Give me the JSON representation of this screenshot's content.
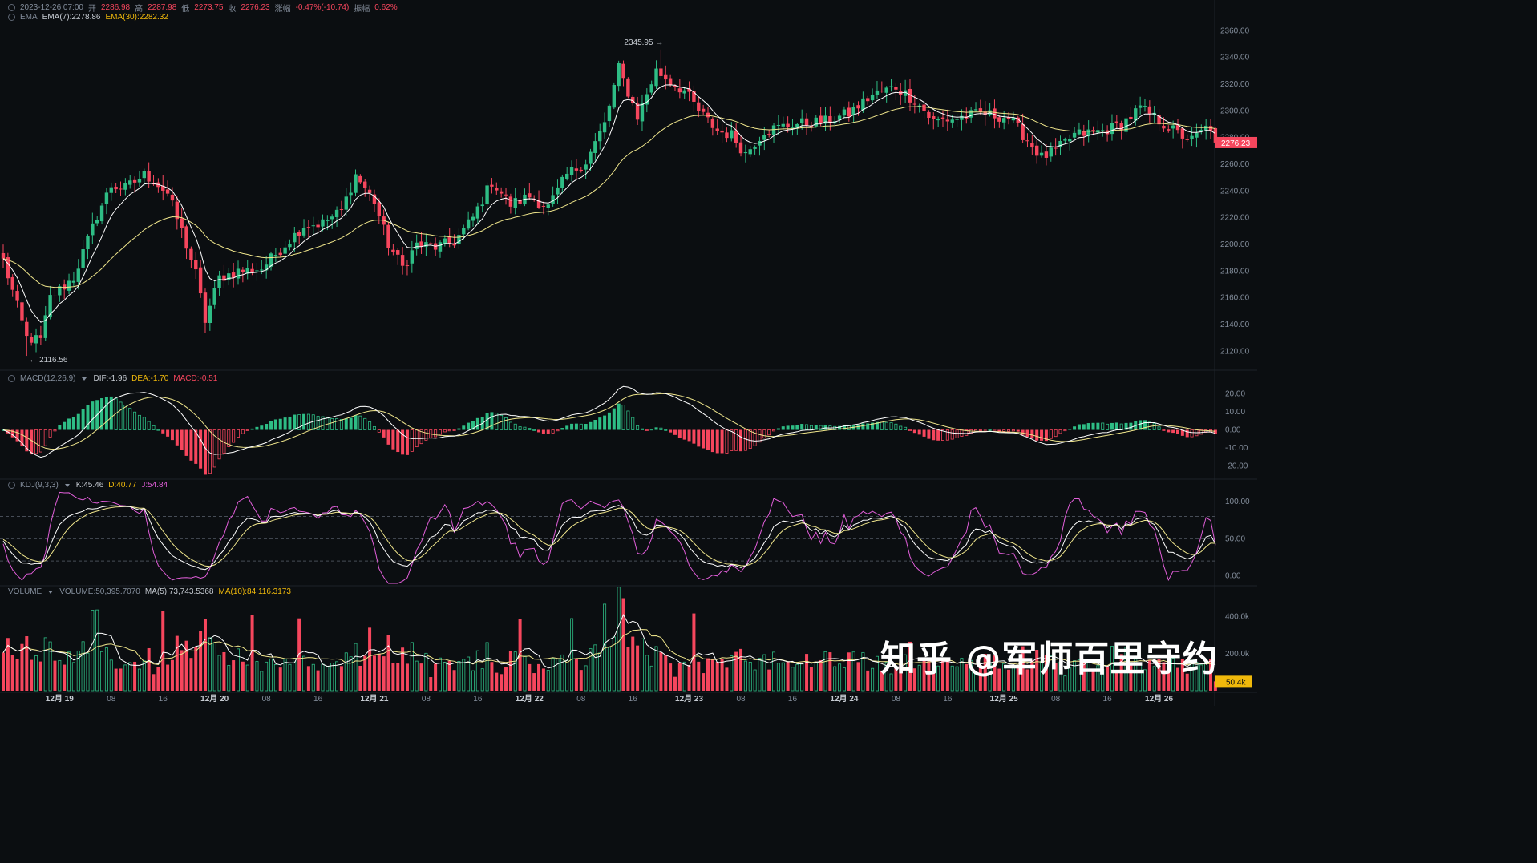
{
  "header": {
    "datetime": "2023-12-26 07:00",
    "open_label": "开",
    "open": "2286.98",
    "high_label": "高",
    "high": "2287.98",
    "low_label": "低",
    "low": "2273.75",
    "close_label": "收",
    "close": "2276.23",
    "change_label": "涨幅",
    "change": "-0.47%(-10.74)",
    "amp_label": "振幅",
    "amp": "0.62%"
  },
  "ema_header": {
    "name": "EMA",
    "ema7": "EMA(7):2278.86",
    "ema30": "EMA(30):2282.32"
  },
  "macd_header": {
    "name": "MACD(12,26,9)",
    "dif": "DIF:-1.96",
    "dea": "DEA:-1.70",
    "macd": "MACD:-0.51"
  },
  "kdj_header": {
    "name": "KDJ(9,3,3)",
    "k": "K:45.46",
    "d": "D:40.77",
    "j": "J:54.84"
  },
  "vol_header": {
    "name": "VOLUME",
    "volume": "VOLUME:50,395.7070",
    "ma5": "MA(5):73,743.5368",
    "ma10": "MA(10):84,116.3173"
  },
  "watermark": "知乎 @军师百里守约",
  "colors": {
    "up": "#2ebd85",
    "down": "#f6465d",
    "ema7": "#ffffff",
    "ema30": "#f0e68c",
    "j": "#e15ed9",
    "bg": "#0b0e11"
  },
  "chart_data": [
    {
      "type": "candlestick",
      "title": "",
      "ylim": [
        2110,
        2365
      ],
      "y_ticks": [
        "2360.00",
        "2340.00",
        "2320.00",
        "2300.00",
        "2280.00",
        "2260.00",
        "2240.00",
        "2220.00",
        "2200.00",
        "2180.00",
        "2160.00",
        "2140.00",
        "2120.00"
      ],
      "x_tick_labels": [
        "12月 19",
        "08",
        "16",
        "12月 20",
        "08",
        "16",
        "12月 21",
        "08",
        "16",
        "12月 22",
        "08",
        "16",
        "12月 23",
        "08",
        "16",
        "12月 24",
        "08",
        "16",
        "12月 25",
        "08",
        "16",
        "12月 26"
      ],
      "last_price": "2276.23",
      "max_annotation": "2345.95",
      "min_annotation": "2116.56",
      "anchors": [
        [
          0,
          2188
        ],
        [
          5,
          2130
        ],
        [
          8,
          2128
        ],
        [
          10,
          2160
        ],
        [
          15,
          2175
        ],
        [
          20,
          2222
        ],
        [
          23,
          2244
        ],
        [
          26,
          2242
        ],
        [
          30,
          2252
        ],
        [
          32,
          2248
        ],
        [
          35,
          2238
        ],
        [
          38,
          2210
        ],
        [
          41,
          2178
        ],
        [
          43,
          2143
        ],
        [
          46,
          2175
        ],
        [
          50,
          2180
        ],
        [
          55,
          2182
        ],
        [
          60,
          2200
        ],
        [
          64,
          2214
        ],
        [
          68,
          2216
        ],
        [
          72,
          2225
        ],
        [
          75,
          2252
        ],
        [
          79,
          2232
        ],
        [
          82,
          2200
        ],
        [
          85,
          2183
        ],
        [
          88,
          2200
        ],
        [
          92,
          2198
        ],
        [
          96,
          2202
        ],
        [
          100,
          2220
        ],
        [
          104,
          2247
        ],
        [
          108,
          2230
        ],
        [
          112,
          2236
        ],
        [
          116,
          2228
        ],
        [
          120,
          2252
        ],
        [
          124,
          2262
        ],
        [
          128,
          2290
        ],
        [
          131,
          2332
        ],
        [
          135,
          2296
        ],
        [
          139,
          2330
        ],
        [
          142,
          2322
        ],
        [
          145,
          2315
        ],
        [
          148,
          2300
        ],
        [
          152,
          2285
        ],
        [
          155,
          2282
        ],
        [
          158,
          2268
        ],
        [
          162,
          2285
        ],
        [
          168,
          2290
        ],
        [
          175,
          2292
        ],
        [
          180,
          2298
        ],
        [
          185,
          2312
        ],
        [
          190,
          2318
        ],
        [
          194,
          2308
        ],
        [
          198,
          2292
        ],
        [
          202,
          2294
        ],
        [
          208,
          2298
        ],
        [
          214,
          2295
        ],
        [
          218,
          2278
        ],
        [
          221,
          2265
        ],
        [
          224,
          2270
        ],
        [
          228,
          2282
        ],
        [
          234,
          2285
        ],
        [
          238,
          2290
        ],
        [
          242,
          2302
        ],
        [
          245,
          2295
        ],
        [
          250,
          2283
        ],
        [
          253,
          2278
        ],
        [
          256,
          2287
        ]
      ],
      "min_index": 5,
      "max_index": 140
    },
    {
      "type": "bar+line",
      "title": "MACD(12,26,9)",
      "ylim": [
        -26,
        26
      ],
      "y_ticks": [
        "20.00",
        "10.00",
        "0.00",
        "-10.00",
        "-20.00"
      ],
      "series": [
        "DIF",
        "DEA",
        "MACD"
      ]
    },
    {
      "type": "line",
      "title": "KDJ(9,3,3)",
      "ylim": [
        -10,
        115
      ],
      "y_ticks": [
        "100.00",
        "50.00",
        "0.00"
      ],
      "reference_lines": [
        80,
        50,
        20
      ],
      "series": [
        "K",
        "D",
        "J"
      ]
    },
    {
      "type": "bar+line",
      "title": "VOLUME",
      "ylim": [
        0,
        520000
      ],
      "y_ticks": [
        "400.0k",
        "200.0k"
      ],
      "last_volume": "50.4k",
      "series": [
        "VOLUME",
        "MA(5)",
        "MA(10)"
      ]
    }
  ]
}
